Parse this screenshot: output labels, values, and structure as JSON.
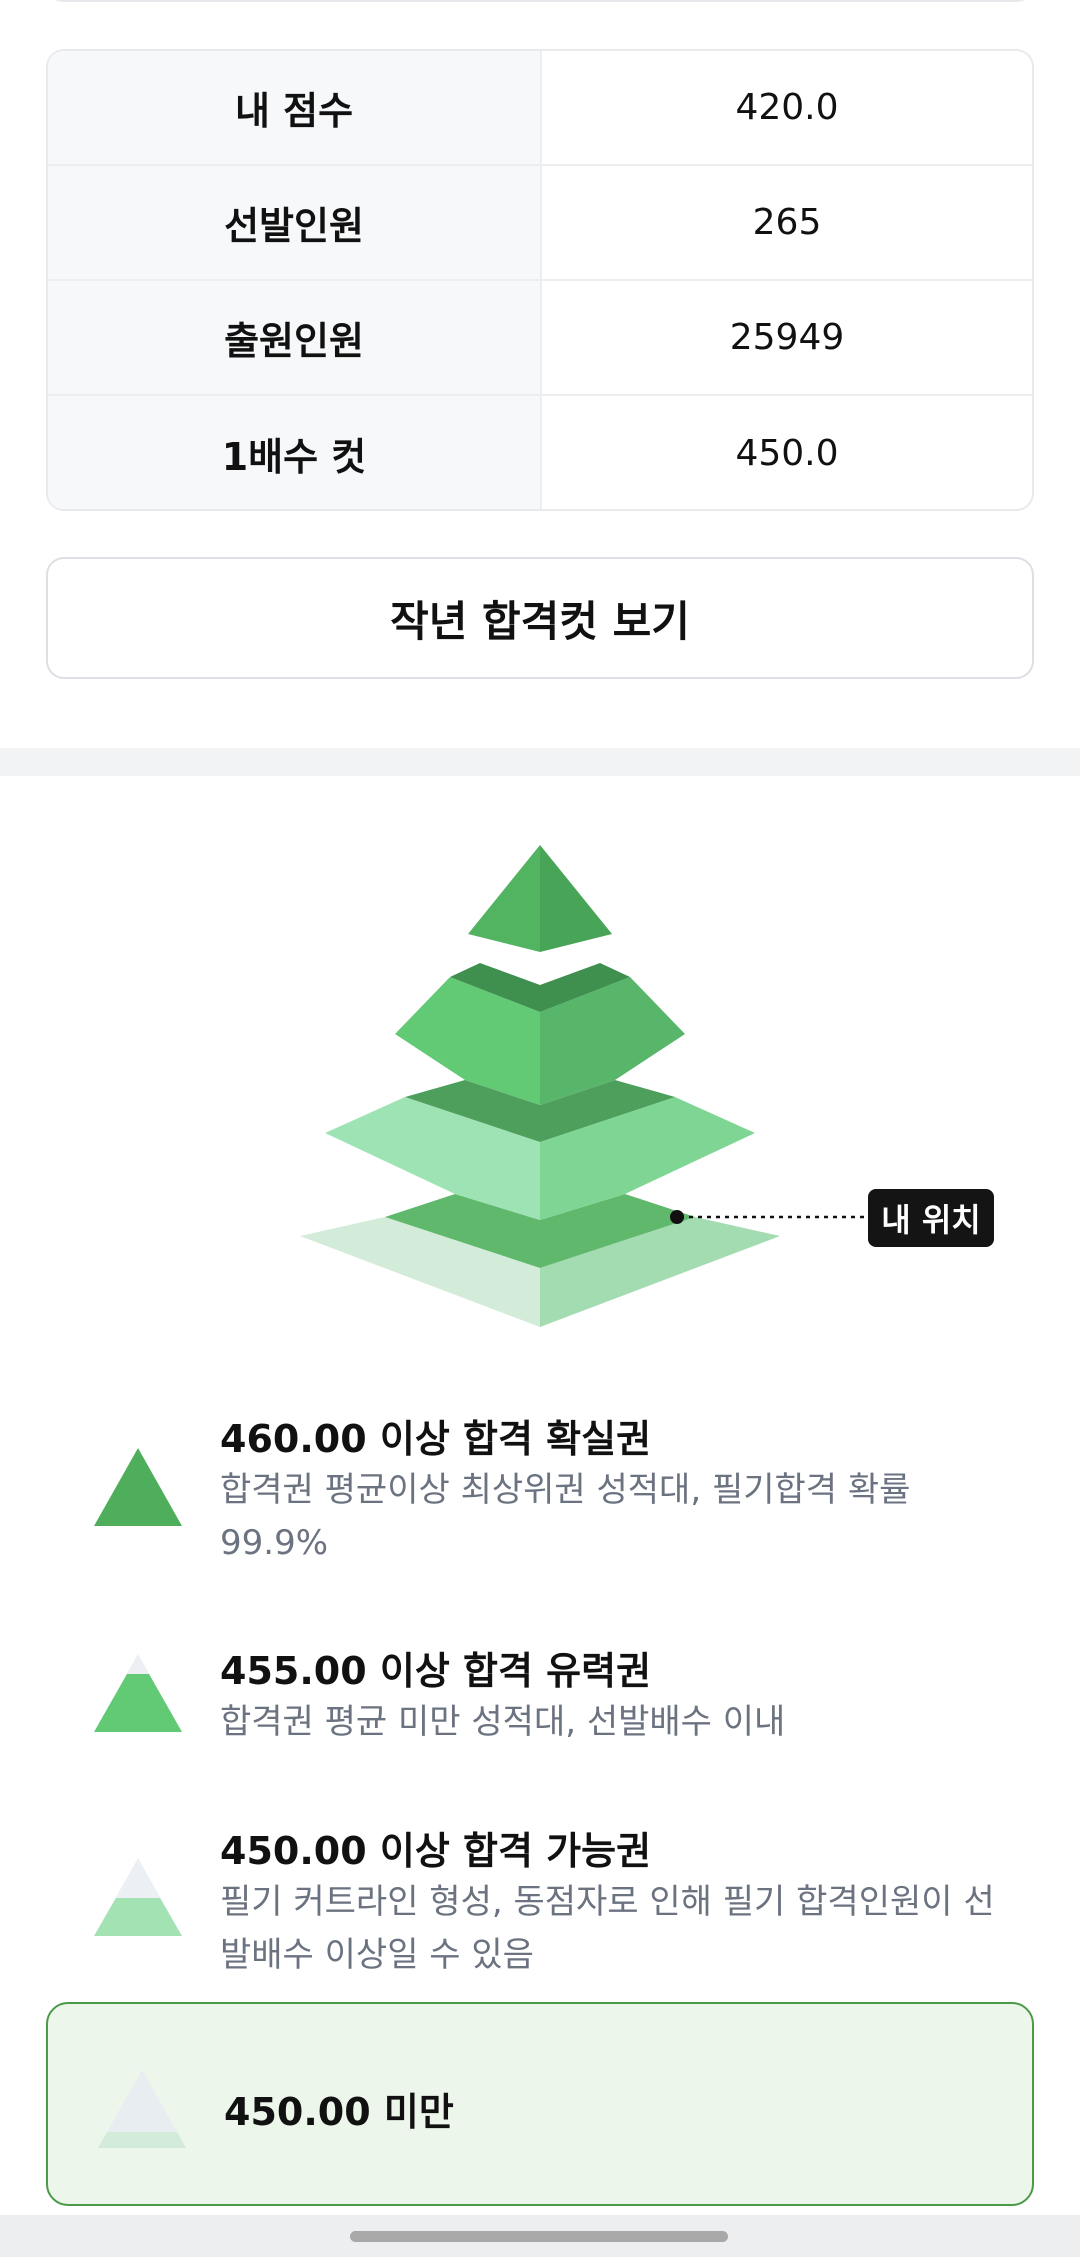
{
  "stats": {
    "rows": [
      {
        "label": "내 점수",
        "value": "420.0"
      },
      {
        "label": "선발인원",
        "value": "265"
      },
      {
        "label": "출원인원",
        "value": "25949"
      },
      {
        "label": "1배수 컷",
        "value": "450.0"
      }
    ]
  },
  "prev_cut_button": "작년 합격컷 보기",
  "pyramid": {
    "my_position_label": "내 위치",
    "colors": {
      "tier1": "#4fae5c",
      "tier2": "#66c977",
      "tier3": "#a3e2b3",
      "tier4": "#d6eedd"
    }
  },
  "legend": {
    "items": [
      {
        "title": "460.00 이상 합격 확실권",
        "desc": "합격권 평균이상 최상위권 성적대, 필기합격 확률 99.9%"
      },
      {
        "title": "455.00 이상 합격 유력권",
        "desc": "합격권 평균 미만 성적대, 선발배수 이내"
      },
      {
        "title": "450.00 이상 합격 가능권",
        "desc": "필기 커트라인 형성, 동점자로 인해 필기 합격인원이 선발배수 이상일 수 있음"
      },
      {
        "title": "450.00 미만",
        "desc": ""
      }
    ]
  }
}
